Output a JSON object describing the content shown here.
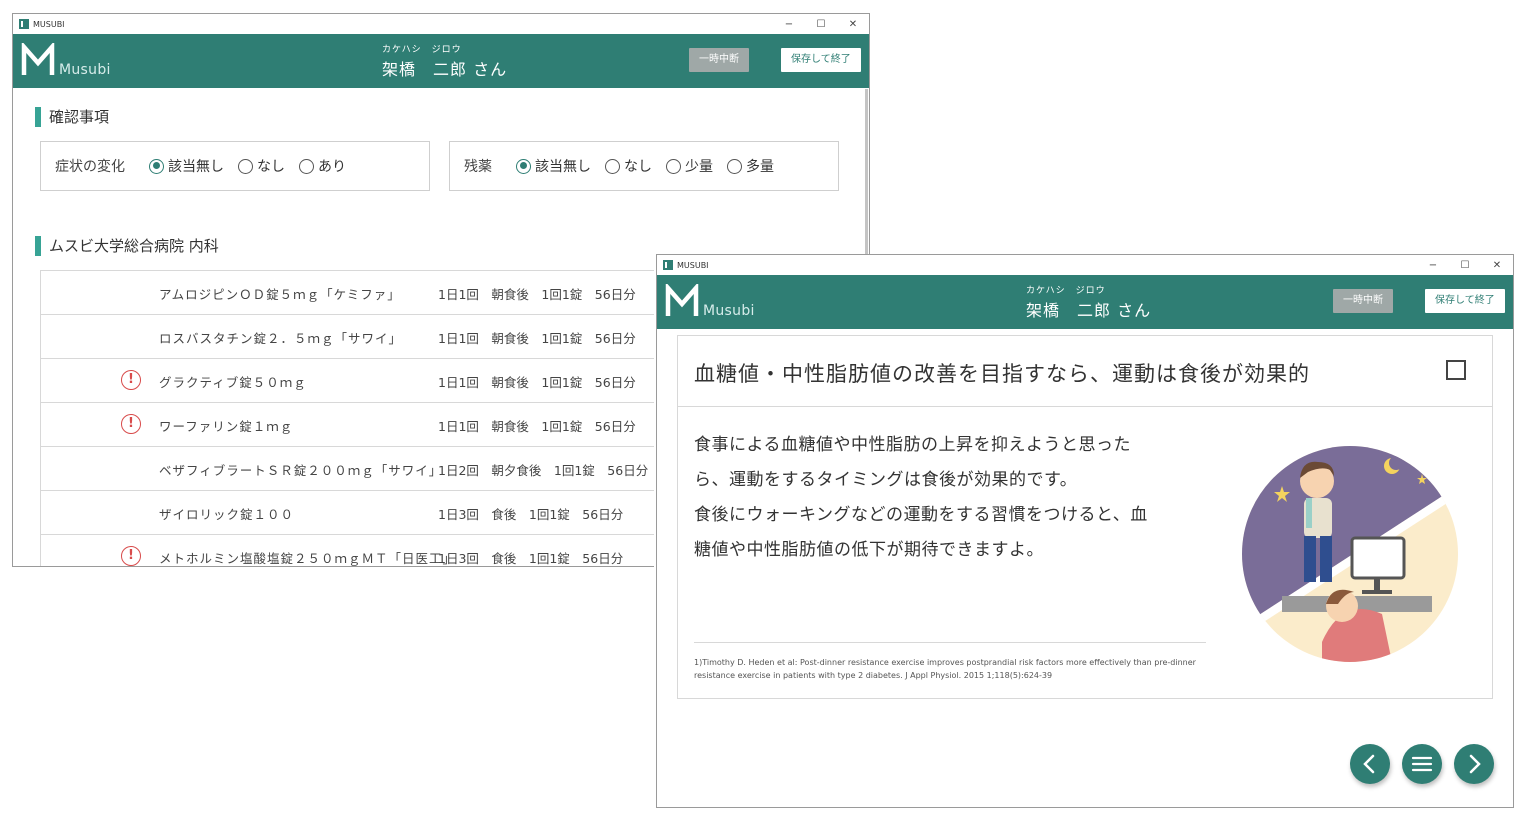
{
  "window_a": {
    "app_title": "MUSUBI",
    "brand": "Musubi",
    "patient_kana": "カケハシ　ジロウ",
    "patient_name": "架橋　二郎 さん",
    "pause_label": "一時中断",
    "save_label": "保存して終了",
    "confirm_title": "確認事項",
    "symptom_box": {
      "label": "症状の変化",
      "options": [
        "該当無し",
        "なし",
        "あり"
      ],
      "selected": "該当無し"
    },
    "leftover_box": {
      "label": "残薬",
      "options": [
        "該当無し",
        "なし",
        "少量",
        "多量"
      ],
      "selected": "該当無し"
    },
    "hospital_title": "ムスビ大学総合病院 内科",
    "meds": [
      {
        "name": "アムロジピンＯＤ錠５ｍｇ「ケミファ」",
        "dose": "1日1回　朝食後　1回1錠　56日分",
        "warning": false
      },
      {
        "name": "ロスバスタチン錠２．５ｍｇ「サワイ」",
        "dose": "1日1回　朝食後　1回1錠　56日分",
        "warning": false
      },
      {
        "name": "グラクティブ錠５０ｍｇ",
        "dose": "1日1回　朝食後　1回1錠　56日分",
        "warning": true
      },
      {
        "name": "ワーファリン錠１ｍｇ",
        "dose": "1日1回　朝食後　1回1錠　56日分",
        "warning": true
      },
      {
        "name": "ベザフィブラートＳＲ錠２００ｍｇ「サワイ」",
        "dose": "1日2回　朝夕食後　1回1錠　56日分",
        "warning": false
      },
      {
        "name": "ザイロリック錠１００",
        "dose": "1日3回　食後　1回1錠　56日分",
        "warning": false
      },
      {
        "name": "メトホルミン塩酸塩錠２５０ｍｇＭＴ「日医工」",
        "dose": "1日3回　食後　1回1錠　56日分",
        "warning": true
      }
    ]
  },
  "window_b": {
    "app_title": "MUSUBI",
    "brand": "Musubi",
    "patient_kana": "カケハシ　ジロウ",
    "patient_name": "架橋　二郎 さん",
    "pause_label": "一時中断",
    "save_label": "保存して終了",
    "card_title": "血糖値・中性脂肪値の改善を目指すなら、運動は食後が効果的",
    "body_lines": [
      "食事による血糖値や中性脂肪の上昇を抑えようと思った",
      "ら、運動をするタイミングは食後が効果的です。",
      "食後にウォーキングなどの運動をする習慣をつけると、血",
      "糖値や中性脂肪値の低下が期待できますよ。"
    ],
    "reference_lines": [
      "1)Timothy D. Heden et al: Post-dinner resistance exercise improves postprandial risk factors more effectively than pre-dinner",
      "resistance exercise in patients with type 2 diabetes. J Appl Physiol. 2015 1;118(5):624-39"
    ]
  },
  "icons": {
    "prev": "chevron-left-icon",
    "menu": "hamburger-menu-icon",
    "next": "chevron-right-icon",
    "warning": "exclamation-circle-icon"
  },
  "colors": {
    "header_teal": "#2f7e74",
    "accent_bar": "#37a395",
    "warning_red": "#d84b4b",
    "pause_gray": "#9fa8a7"
  }
}
